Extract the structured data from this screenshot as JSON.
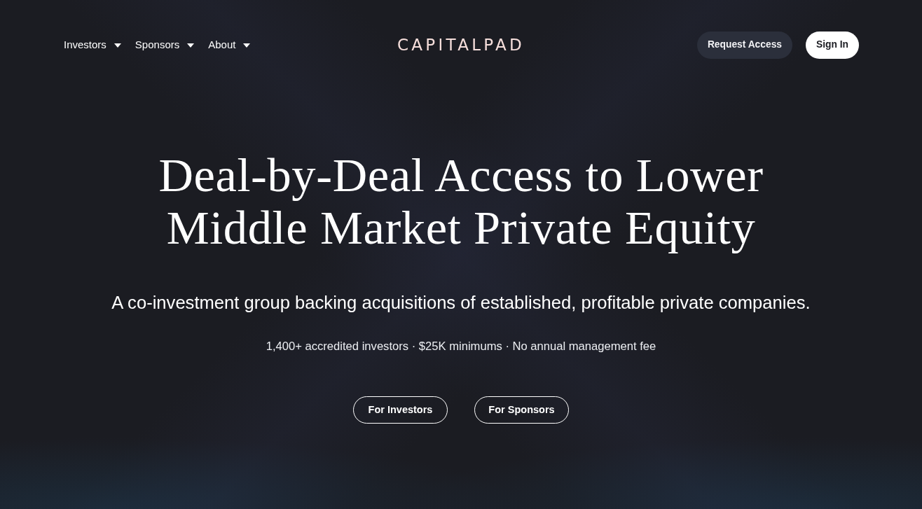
{
  "nav": {
    "menus": [
      {
        "label": "Investors"
      },
      {
        "label": "Sponsors"
      },
      {
        "label": "About"
      }
    ],
    "logo": "CAPITALPAD",
    "actions": [
      {
        "label": "Request Access",
        "kind": "secondary"
      },
      {
        "label": "Sign In",
        "kind": "primary"
      }
    ]
  },
  "hero": {
    "title_lines": [
      "Deal-by-Deal Access to Lower",
      "Middle Market Private Equity"
    ],
    "subtitle": "A co-investment group backing acquisitions of established, profitable private companies.",
    "stats": "1,400+ accredited investors · $25K minimums · No annual management fee",
    "buttons": [
      {
        "label": "For Investors"
      },
      {
        "label": "For Sponsors"
      }
    ]
  }
}
